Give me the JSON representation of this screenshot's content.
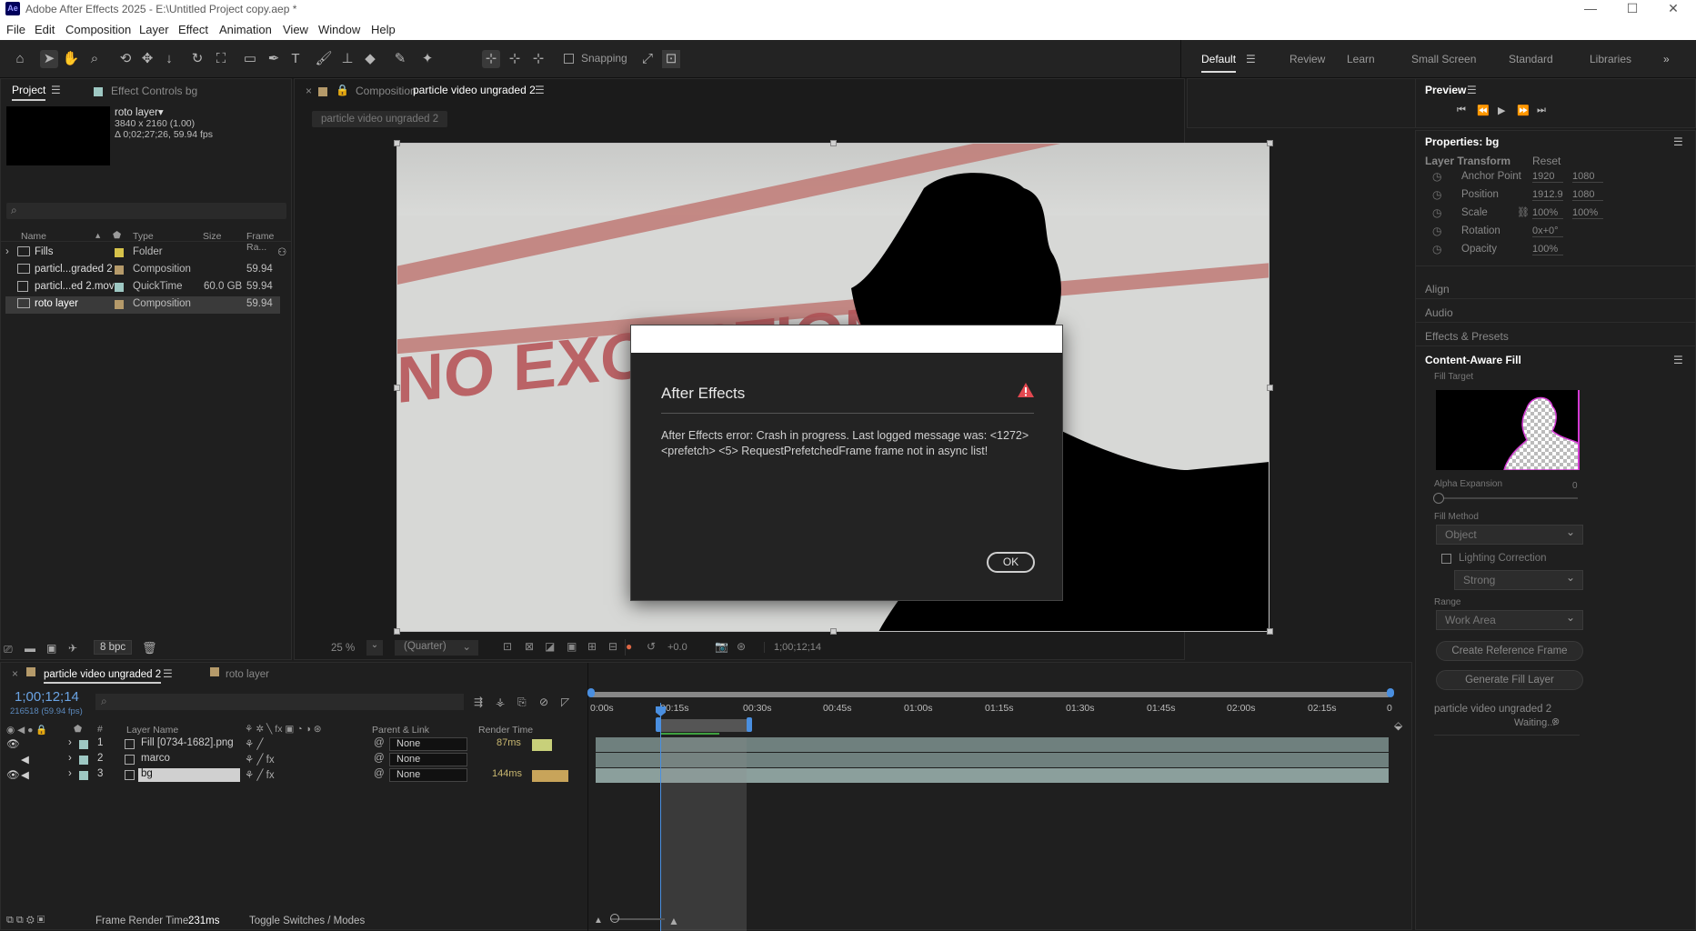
{
  "window": {
    "title": "Adobe After Effects 2025 - E:\\Untitled Project copy.aep *",
    "app_badge": "Ae"
  },
  "menu": [
    "File",
    "Edit",
    "Composition",
    "Layer",
    "Effect",
    "Animation",
    "View",
    "Window",
    "Help"
  ],
  "toolbar": {
    "snapping_label": "Snapping"
  },
  "workspaces": [
    "Default",
    "Review",
    "Learn",
    "Small Screen",
    "Standard",
    "Libraries"
  ],
  "project": {
    "tab_project": "Project",
    "tab_effect_controls": "Effect Controls bg",
    "selected_name": "roto layer▾",
    "selected_res": "3840 x 2160 (1.00)",
    "selected_dur": "Δ 0;02;27;26, 59.94 fps",
    "search_placeholder": "",
    "columns": {
      "name": "Name",
      "type": "Type",
      "size": "Size",
      "rate": "Frame Ra..."
    },
    "items": [
      {
        "name": "Fills",
        "type": "Folder",
        "size": "",
        "rate": "",
        "color": "#d6c24a"
      },
      {
        "name": "particl...graded 2",
        "type": "Composition",
        "size": "",
        "rate": "59.94",
        "color": "#b59a6a"
      },
      {
        "name": "particl...ed 2.mov",
        "type": "QuickTime",
        "size": "60.0 GB",
        "rate": "59.94",
        "color": "#9ec8c3"
      },
      {
        "name": "roto layer",
        "type": "Composition",
        "size": "",
        "rate": "59.94",
        "color": "#b59a6a"
      }
    ],
    "bpc": "8 bpc"
  },
  "comp": {
    "tab_prefix": "Composition",
    "tab_name": "particle video ungraded 2",
    "breadcrumb": "particle video ungraded 2",
    "zoom": "25 %",
    "resolution": "(Quarter)",
    "exposure": "+0.0",
    "timecode": "1;00;12;14",
    "footage_text": "NO EXCEPTIONS"
  },
  "dialog": {
    "title": "After Effects",
    "message": "After Effects error: Crash in progress. Last logged message was: <1272> <prefetch> <5> RequestPrefetchedFrame frame not in async list!",
    "ok": "OK"
  },
  "preview": {
    "title": "Preview"
  },
  "properties": {
    "title": "Properties: bg",
    "section": "Layer Transform",
    "reset": "Reset",
    "rows": [
      {
        "label": "Anchor Point",
        "v1": "1920",
        "v2": "1080"
      },
      {
        "label": "Position",
        "v1": "1912.9",
        "v2": "1080"
      },
      {
        "label": "Scale",
        "v1": "100%",
        "v2": "100%"
      },
      {
        "label": "Rotation",
        "v1": "0x+0°",
        "v2": ""
      },
      {
        "label": "Opacity",
        "v1": "100%",
        "v2": ""
      }
    ]
  },
  "side_sections": [
    "Align",
    "Audio",
    "Effects & Presets"
  ],
  "caf": {
    "title": "Content-Aware Fill",
    "fill_target": "Fill Target",
    "alpha_expansion": "Alpha Expansion",
    "alpha_value": "0",
    "fill_method": "Fill Method",
    "fill_method_value": "Object",
    "lighting_correction": "Lighting Correction",
    "lighting_value": "Strong",
    "range": "Range",
    "range_value": "Work Area",
    "create_ref": "Create Reference Frame",
    "generate": "Generate Fill Layer",
    "job_name": "particle video ungraded 2",
    "job_status": "Waiting..."
  },
  "timeline": {
    "tab_active": "particle video ungraded 2",
    "tab_other": "roto layer",
    "timecode": "1;00;12;14",
    "frame_info": "216518 (59.94 fps)",
    "col_layer_name": "Layer Name",
    "col_parent": "Parent & Link",
    "col_render": "Render Time",
    "ruler": [
      "0:00s",
      "00:15s",
      "00:30s",
      "00:45s",
      "01:00s",
      "01:15s",
      "01:30s",
      "01:45s",
      "02:00s",
      "02:15s",
      "0"
    ],
    "layers": [
      {
        "num": "1",
        "name": "Fill [0734-1682].png",
        "parent": "None",
        "render": "87ms",
        "render_fill": 0.55,
        "color": "#9ec8c3"
      },
      {
        "num": "2",
        "name": "marco",
        "parent": "None",
        "render": "",
        "render_fill": 0,
        "color": "#9ec8c3"
      },
      {
        "num": "3",
        "name": "bg",
        "parent": "None",
        "render": "144ms",
        "render_fill": 1.0,
        "color": "#9ec8c3"
      }
    ],
    "frame_render_label": "Frame Render Time:",
    "frame_render_value": "231ms",
    "toggle": "Toggle Switches / Modes"
  }
}
